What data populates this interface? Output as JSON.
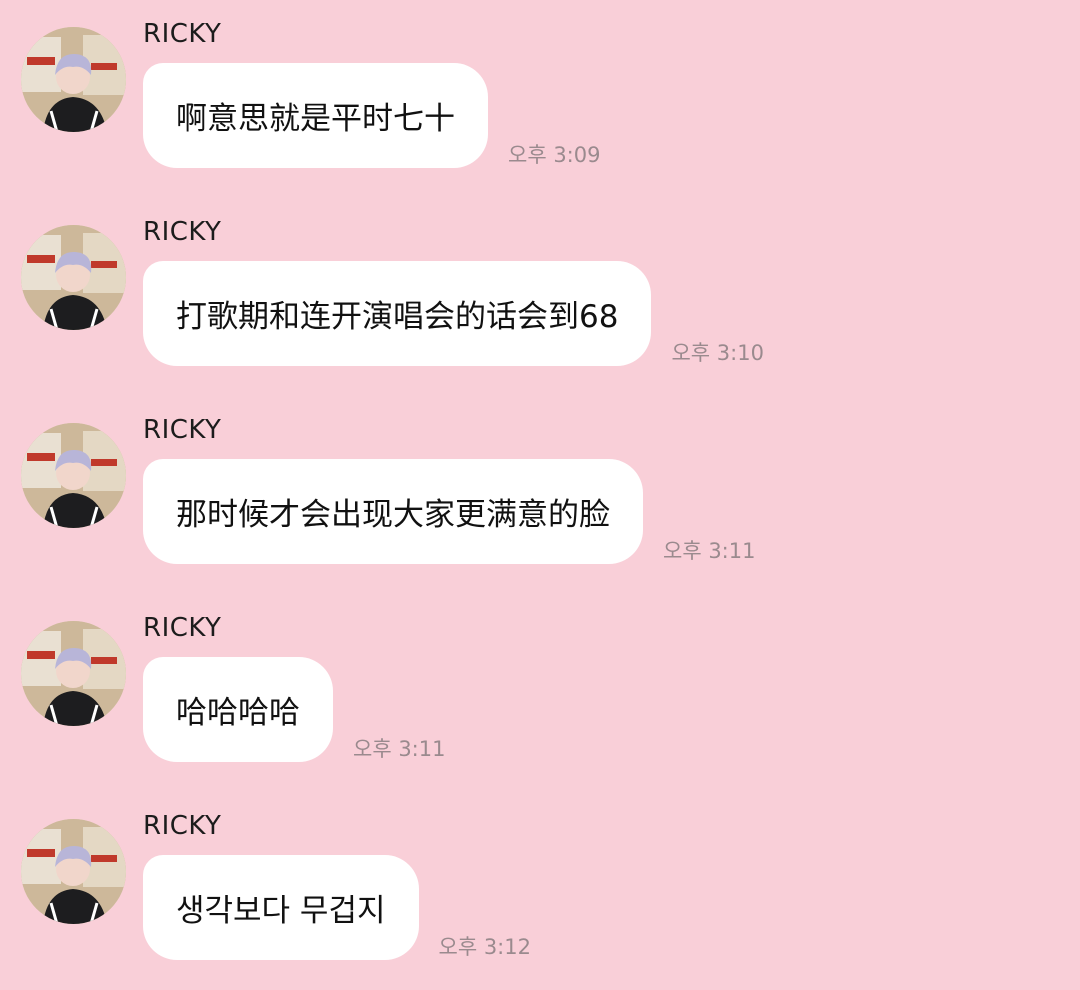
{
  "messages": [
    {
      "sender": "RICKY",
      "text": "啊意思就是平时七十",
      "time": "오후 3:09"
    },
    {
      "sender": "RICKY",
      "text": "打歌期和连开演唱会的话会到68",
      "time": "오후 3:10"
    },
    {
      "sender": "RICKY",
      "text": "那时候才会出现大家更满意的脸",
      "time": "오후 3:11"
    },
    {
      "sender": "RICKY",
      "text": "哈哈哈哈",
      "time": "오후 3:11"
    },
    {
      "sender": "RICKY",
      "text": "생각보다 무겁지",
      "time": "오후 3:12"
    }
  ],
  "colors": {
    "background": "#f9cfd8",
    "bubble": "#ffffff",
    "timestamp": "#9a8a8e"
  },
  "icons": {
    "avatar": "user-profile-photo"
  }
}
